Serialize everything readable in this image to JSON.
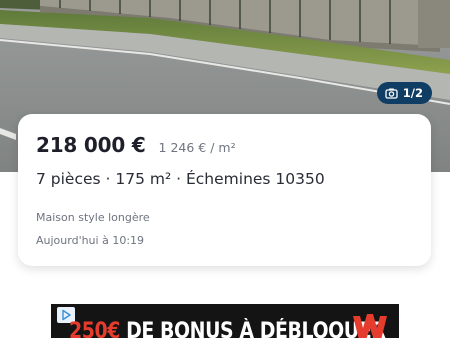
{
  "photo": {
    "counter": "1/2",
    "counter_icon": "camera-icon",
    "accent_color": "#0f3d63"
  },
  "listing": {
    "price": "218 000 €",
    "price_per_sqm": "1 246 € / m²",
    "details": "7 pièces · 175 m² · Échemines 10350",
    "subtitle": "Maison style longère",
    "date": "Aujourd'hui à 10:19"
  },
  "ad": {
    "amount": "250€",
    "text": "DE BONUS À DÉBLOQUER",
    "choices_icon": "ad-choices-icon",
    "logo_icon": "brand-logo-icon",
    "accent_color": "#e53c2e"
  }
}
